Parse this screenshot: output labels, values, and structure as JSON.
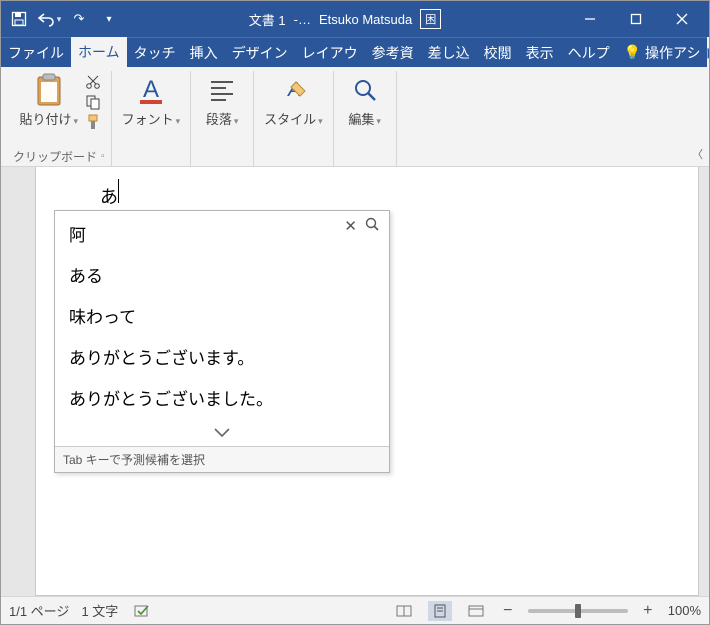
{
  "title": {
    "doc": "文書 1",
    "sep": "-…",
    "user": "Etsuko Matsuda"
  },
  "tabs": {
    "file": "ファイル",
    "home": "ホーム",
    "touch": "タッチ",
    "insert": "挿入",
    "design": "デザイン",
    "layout": "レイアウ",
    "ref": "参考資",
    "mail": "差し込",
    "review": "校閲",
    "view": "表示",
    "help": "ヘルプ",
    "tell": "操作アシ"
  },
  "ribbon": {
    "paste": "貼り付け",
    "clipboard": "クリップボード",
    "font": "フォント",
    "para": "段落",
    "style": "スタイル",
    "edit": "編集"
  },
  "doc": {
    "typed": "あ"
  },
  "ime": {
    "items": [
      "阿",
      "ある",
      "味わって",
      "ありがとうございます。",
      "ありがとうございました。"
    ],
    "hint": "Tab キーで予測候補を選択"
  },
  "status": {
    "page": "1/1 ページ",
    "words": "1 文字",
    "zoom": "100%"
  }
}
